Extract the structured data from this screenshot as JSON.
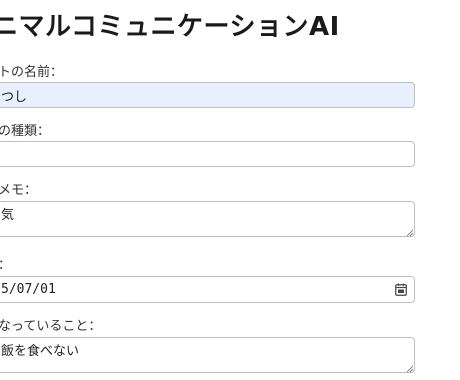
{
  "app": {
    "title": "ニマルコミュニケーションAI"
  },
  "form": {
    "name": {
      "label": "トの名前：",
      "value": "つし"
    },
    "type": {
      "label": "の種類：",
      "value": ""
    },
    "memo": {
      "label": "メモ：",
      "value": "気"
    },
    "date": {
      "label": "：",
      "value": "5/07/01"
    },
    "concern": {
      "label": "なっていること：",
      "value": "飯を食べない"
    }
  },
  "icons": {
    "calendar": "calendar-icon",
    "resize": "resize-grip-icon"
  },
  "colors": {
    "autofill_background": "#e8f0fe",
    "border": "#bfbfbf"
  }
}
